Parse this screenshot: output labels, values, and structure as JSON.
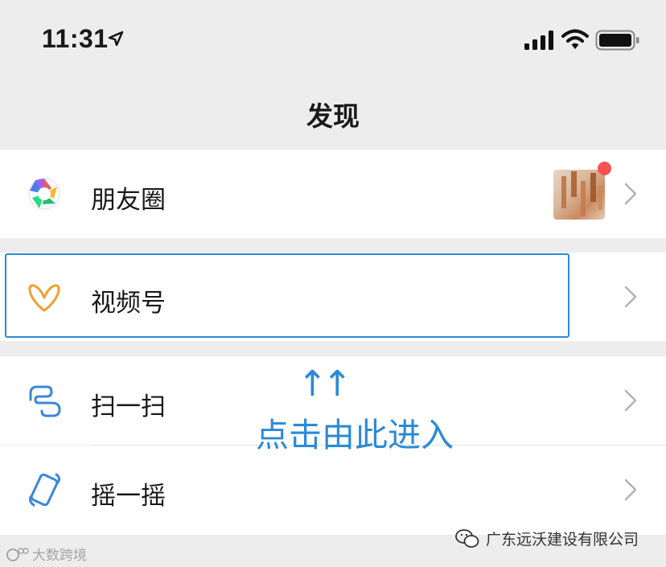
{
  "status_bar": {
    "time": "11:31"
  },
  "nav": {
    "title": "发现"
  },
  "items": [
    {
      "label": "朋友圈",
      "icon": "moments-aperture-icon"
    },
    {
      "label": "视频号",
      "icon": "channels-butterfly-icon"
    },
    {
      "label": "扫一扫",
      "icon": "scan-icon"
    },
    {
      "label": "摇一摇",
      "icon": "shake-icon"
    }
  ],
  "annotation": {
    "arrows": "↑↑",
    "text": "点击由此进入"
  },
  "watermarks": {
    "right": "广东远沃建设有限公司",
    "left": "大数跨境"
  },
  "colors": {
    "accent": "#2b8ad6",
    "badge": "#fa5151",
    "background": "#ededed"
  }
}
